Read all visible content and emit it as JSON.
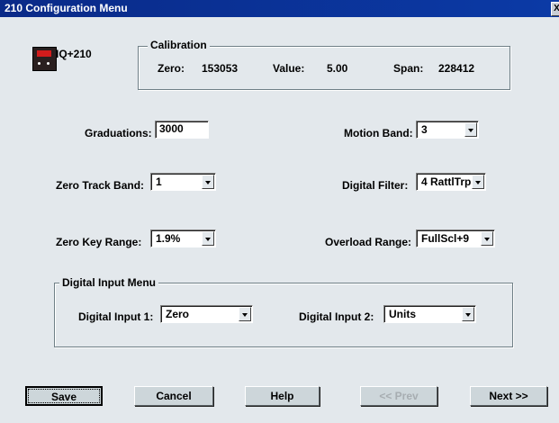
{
  "window": {
    "title": "210 Configuration Menu",
    "close_label": "X"
  },
  "device": {
    "label": "IQ+210"
  },
  "calibration": {
    "title": "Calibration",
    "zero_label": "Zero:",
    "zero_value": "153053",
    "value_label": "Value:",
    "value_value": "5.00",
    "span_label": "Span:",
    "span_value": "228412"
  },
  "settings": {
    "graduations_label": "Graduations:",
    "graduations_value": "3000",
    "motion_band_label": "Motion Band:",
    "motion_band_value": "3",
    "zero_track_band_label": "Zero Track Band:",
    "zero_track_band_value": "1",
    "digital_filter_label": "Digital Filter:",
    "digital_filter_value": "4 RattlTrp",
    "zero_key_range_label": "Zero Key Range:",
    "zero_key_range_value": "1.9%",
    "overload_range_label": "Overload Range:",
    "overload_range_value": "FullScl+9"
  },
  "digital_input": {
    "title": "Digital Input Menu",
    "input1_label": "Digital Input 1:",
    "input1_value": "Zero",
    "input2_label": "Digital Input 2:",
    "input2_value": "Units"
  },
  "buttons": {
    "save": "Save",
    "cancel": "Cancel",
    "help": "Help",
    "prev": "<< Prev",
    "next": "Next >>"
  }
}
